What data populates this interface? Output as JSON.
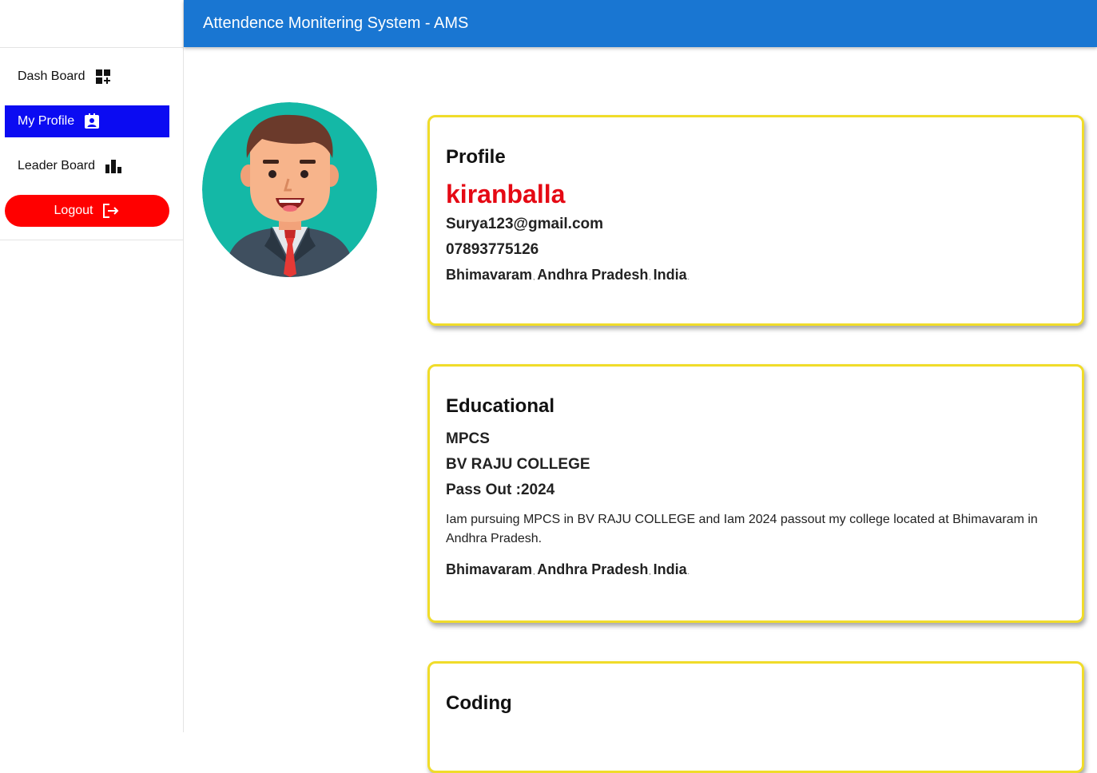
{
  "header": {
    "title": "Attendence Monitering System - AMS"
  },
  "sidebar": {
    "items": [
      {
        "label": "Dash Board",
        "icon": "dashboard-icon"
      },
      {
        "label": "My Profile",
        "icon": "contact-icon",
        "active": true
      },
      {
        "label": "Leader Board",
        "icon": "bar-chart-icon"
      }
    ],
    "logout_label": "Logout"
  },
  "profile": {
    "heading": "Profile",
    "name": "kiranballa",
    "email": "Surya123@gmail.com",
    "phone": "07893775126",
    "city": "Bhimavaram",
    "state": "Andhra Pradesh",
    "country": "India"
  },
  "education": {
    "heading": "Educational",
    "course": "MPCS",
    "college": "BV RAJU COLLEGE",
    "passout": "Pass Out :2024",
    "description": "Iam pursuing MPCS in BV RAJU COLLEGE and Iam 2024 passout my college located at Bhimavaram in Andhra Pradesh.",
    "city": "Bhimavaram",
    "state": "Andhra Pradesh",
    "country": "India"
  },
  "coding": {
    "heading": "Coding"
  },
  "colors": {
    "header": "#1976d2",
    "active_nav": "#0b0bf2",
    "logout": "#ff0000",
    "name": "#e50914",
    "card_border": "#f0dc2a"
  }
}
